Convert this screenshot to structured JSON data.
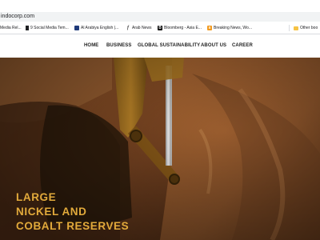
{
  "browser": {
    "url": "indocorp.com",
    "bookmarks": [
      {
        "label": "Media Rel...",
        "icon": "page-icon",
        "color": "#4a4a4a"
      },
      {
        "label": "9 Social Media Tem...",
        "icon": "document-icon",
        "color": "#202124"
      },
      {
        "label": "Al Arabiya English |...",
        "icon": "alarabiya-icon",
        "color": "#203a7a"
      },
      {
        "label": "Arab News",
        "icon": "arab-news-icon",
        "color": "#6b6b6b"
      },
      {
        "label": "Bloomberg - Asia E...",
        "icon": "bloomberg-icon",
        "color": "#000000"
      },
      {
        "label": "Breaking News, Wo...",
        "icon": "breaking-news-icon",
        "color": "#f29a1f"
      }
    ],
    "other_bookmarks": "Other boo"
  },
  "nav": {
    "items": [
      "HOME",
      "BUSINESS",
      "GLOBAL SUSTAINABILITY",
      "ABOUT US",
      "CAREER"
    ]
  },
  "hero": {
    "title_lines": [
      "LARGE",
      "NICKEL AND",
      "COBALT RESERVES"
    ],
    "title_color": "#e2aa3b"
  }
}
